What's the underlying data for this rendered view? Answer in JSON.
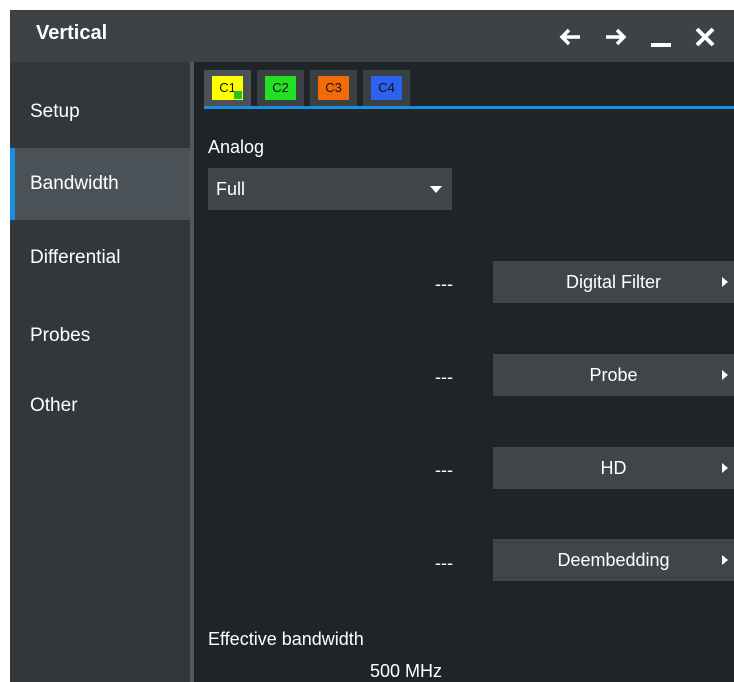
{
  "window": {
    "title": "Vertical"
  },
  "titlebar_icons": [
    "back-arrow-icon",
    "forward-arrow-icon",
    "minimize-icon",
    "close-icon"
  ],
  "sidebar": {
    "items": [
      {
        "label": "Setup",
        "active": false
      },
      {
        "label": "Bandwidth",
        "active": true
      },
      {
        "label": "Differential",
        "active": false
      },
      {
        "label": "Probes",
        "active": false
      },
      {
        "label": "Other",
        "active": false
      }
    ]
  },
  "channel_tabs": [
    {
      "label": "C1",
      "color": "#ffff00",
      "active": true
    },
    {
      "label": "C2",
      "color": "#22e022",
      "active": false
    },
    {
      "label": "C3",
      "color": "#f26a0a",
      "active": false
    },
    {
      "label": "C4",
      "color": "#2b63f0",
      "active": false
    }
  ],
  "analog": {
    "label": "Analog",
    "value": "Full"
  },
  "rows": [
    {
      "value": "---",
      "button": "Digital Filter"
    },
    {
      "value": "---",
      "button": "Probe"
    },
    {
      "value": "---",
      "button": "HD"
    },
    {
      "value": "---",
      "button": "Deembedding"
    }
  ],
  "effective_bandwidth": {
    "label": "Effective bandwidth",
    "value": "500 MHz"
  },
  "colors": {
    "accent": "#1a8fe0",
    "titlebar": "#3d4246",
    "sidebar": "#31373b",
    "content": "#1f2427"
  }
}
